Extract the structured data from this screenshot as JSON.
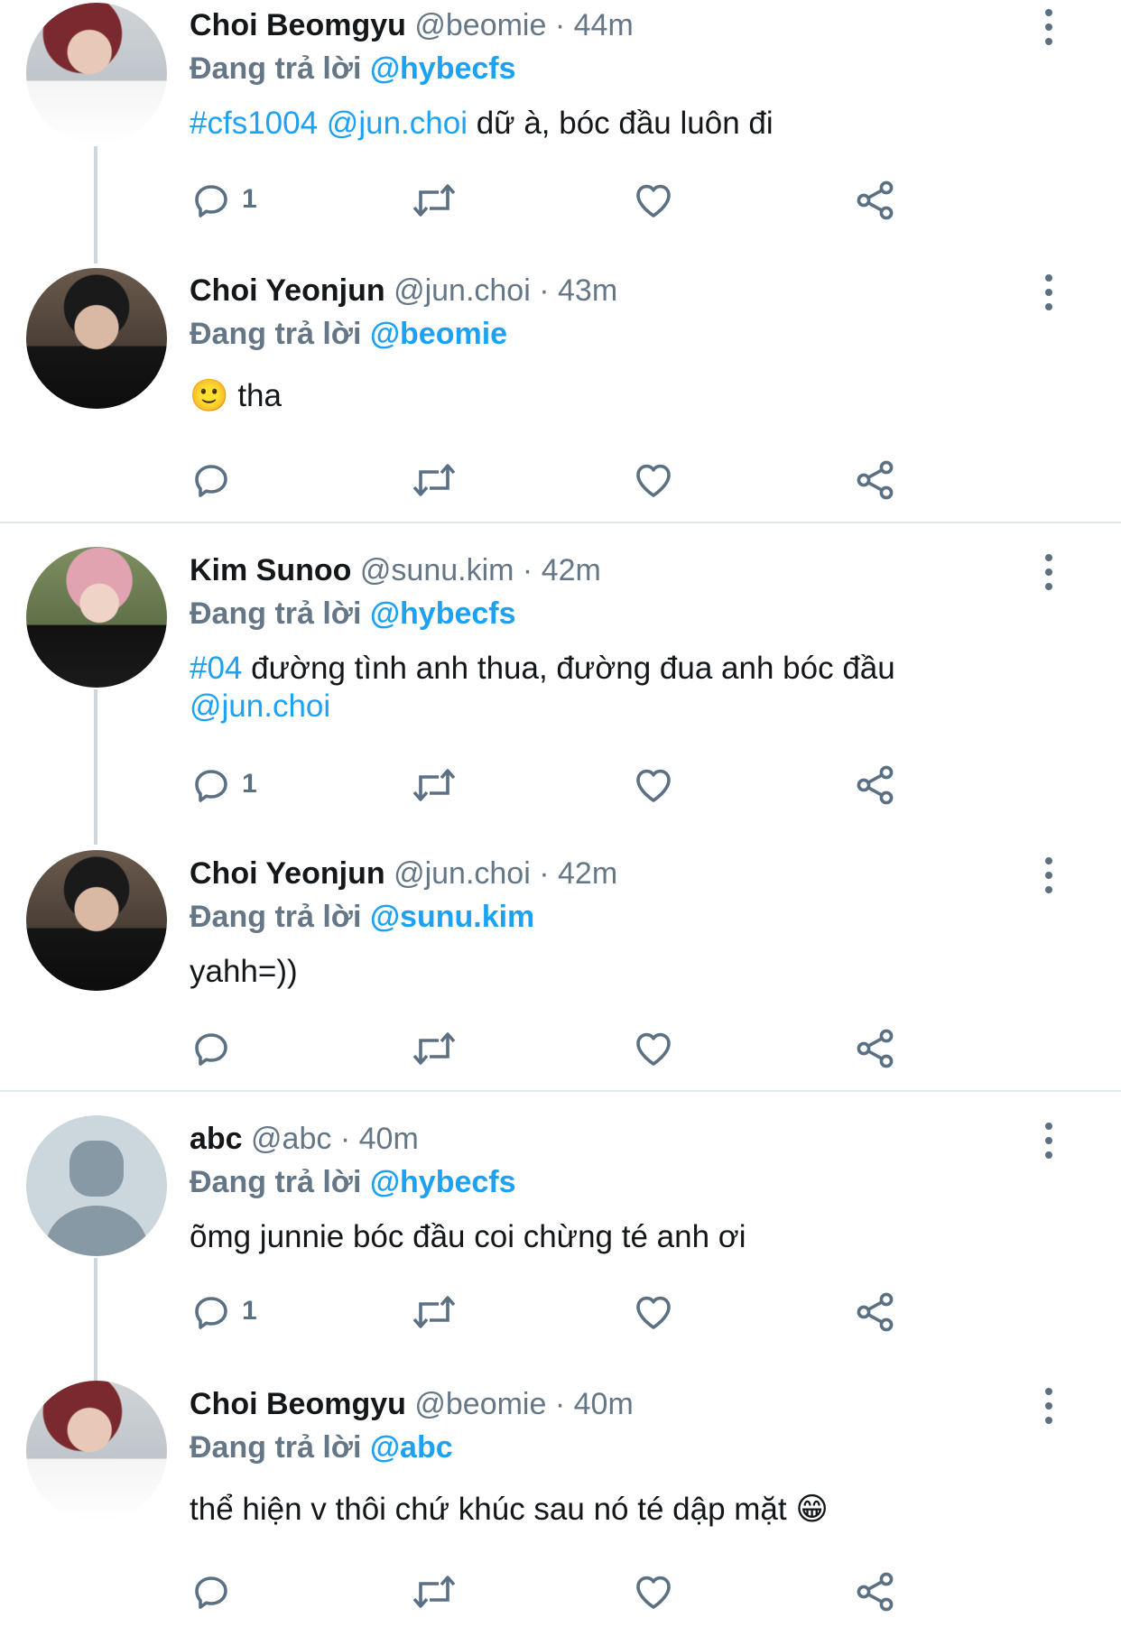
{
  "colors": {
    "accent": "#1da1f2",
    "secondary_text": "#657786",
    "icon": "#5b7083",
    "divider": "#e1e8ed"
  },
  "tweets": [
    {
      "name": "Choi Beomgyu",
      "handle": "@beomie",
      "dot": "·",
      "time": "44m",
      "reply_prefix": "Đang trả lời",
      "reply_to": "@hybecfs",
      "text_hashtag": "#cfs1004",
      "text_mention": "@jun.choi",
      "text_rest": " dữ à, bóc đầu luôn đi",
      "reply_count": "1",
      "avatar": "beomgyu-avatar"
    },
    {
      "name": "Choi Yeonjun",
      "handle": "@jun.choi",
      "dot": "·",
      "time": "43m",
      "reply_prefix": "Đang trả lời",
      "reply_to": "@beomie",
      "emoji": "🙂",
      "text_rest": "tha",
      "reply_count": "",
      "avatar": "yeonjun-avatar"
    },
    {
      "name": "Kim Sunoo",
      "handle": "@sunu.kim",
      "dot": "·",
      "time": "42m",
      "reply_prefix": "Đang trả lời",
      "reply_to": "@hybecfs",
      "text_hashtag": "#04",
      "text_rest": " đường tình anh thua, đường đua anh bóc đầu",
      "text_mention": "@jun.choi",
      "reply_count": "1",
      "avatar": "sunoo-avatar"
    },
    {
      "name": "Choi Yeonjun",
      "handle": "@jun.choi",
      "dot": "·",
      "time": "42m",
      "reply_prefix": "Đang trả lời",
      "reply_to": "@sunu.kim",
      "text_rest": "yahh=))",
      "reply_count": "",
      "avatar": "yeonjun-avatar"
    },
    {
      "name": "abc",
      "handle": "@abc",
      "dot": "·",
      "time": "40m",
      "reply_prefix": "Đang trả lời",
      "reply_to": "@hybecfs",
      "text_rest": "õmg junnie bóc đầu coi chừng té anh ơi",
      "reply_count": "1",
      "avatar": "default-avatar"
    },
    {
      "name": "Choi Beomgyu",
      "handle": "@beomie",
      "dot": "·",
      "time": "40m",
      "reply_prefix": "Đang trả lời",
      "reply_to": "@abc",
      "text_rest": "thể hiện v thôi chứ khúc sau nó té dập mặt ",
      "emoji": "😁",
      "reply_count": "",
      "avatar": "beomgyu-avatar"
    }
  ]
}
